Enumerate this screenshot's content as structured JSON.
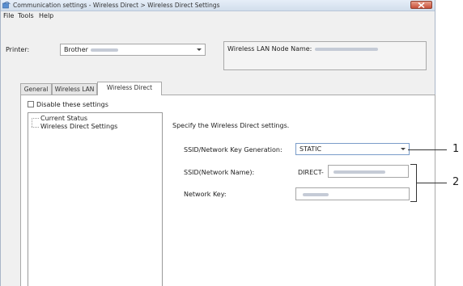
{
  "window": {
    "title": "Communication settings - Wireless Direct > Wireless Direct Settings",
    "menu": [
      "File",
      "Tools",
      "Help"
    ]
  },
  "printer": {
    "label": "Printer:",
    "value": "Brother",
    "node_name_label": "Wireless LAN Node Name:"
  },
  "tabs": [
    {
      "label": "General",
      "active": false
    },
    {
      "label": "Wireless LAN",
      "active": false
    },
    {
      "label": "Wireless Direct",
      "active": true
    }
  ],
  "disable_checkbox": {
    "label": "Disable these settings",
    "checked": false
  },
  "tree": {
    "items": [
      "Current Status",
      "Wireless Direct Settings"
    ]
  },
  "settings": {
    "description": "Specify the Wireless Direct settings.",
    "ssid_generation_label": "SSID/Network Key Generation:",
    "ssid_generation_value": "STATIC",
    "ssid_label": "SSID(Network Name):",
    "ssid_prefix": "DIRECT-",
    "network_key_label": "Network Key:"
  },
  "callouts": [
    "1",
    "2"
  ]
}
